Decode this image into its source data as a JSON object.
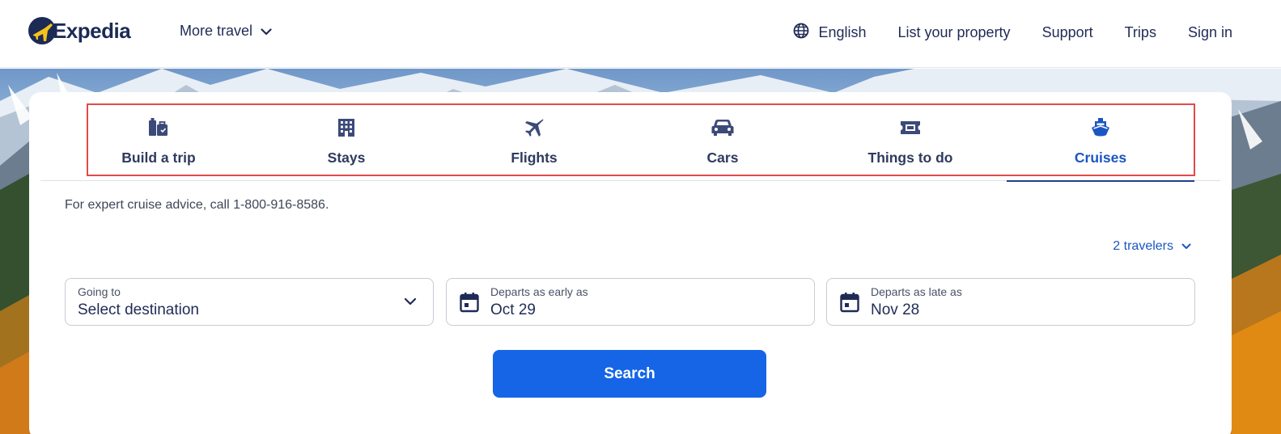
{
  "header": {
    "logo_text": "Expedia",
    "more_travel_label": "More travel",
    "nav": {
      "language": "English",
      "list_property": "List your property",
      "support": "Support",
      "trips": "Trips",
      "sign_in": "Sign in"
    }
  },
  "tabs": [
    {
      "label": "Build a trip",
      "icon": "luggage-icon",
      "active": false
    },
    {
      "label": "Stays",
      "icon": "building-icon",
      "active": false
    },
    {
      "label": "Flights",
      "icon": "airplane-icon",
      "active": false
    },
    {
      "label": "Cars",
      "icon": "car-icon",
      "active": false
    },
    {
      "label": "Things to do",
      "icon": "ticket-icon",
      "active": false
    },
    {
      "label": "Cruises",
      "icon": "ship-icon",
      "active": true
    }
  ],
  "cruise": {
    "advice_text": "For expert cruise advice, call 1-800-916-8586.",
    "travelers_label": "2 travelers",
    "going_to": {
      "label": "Going to",
      "value": "Select destination"
    },
    "departs_early": {
      "label": "Departs as early as",
      "value": "Oct 29"
    },
    "departs_late": {
      "label": "Departs as late as",
      "value": "Nov 28"
    },
    "search_label": "Search"
  },
  "colors": {
    "brand_navy": "#1b2b55",
    "link_blue": "#1a56c2",
    "search_button": "#1565e6",
    "highlight_outline": "#e34a4a"
  }
}
